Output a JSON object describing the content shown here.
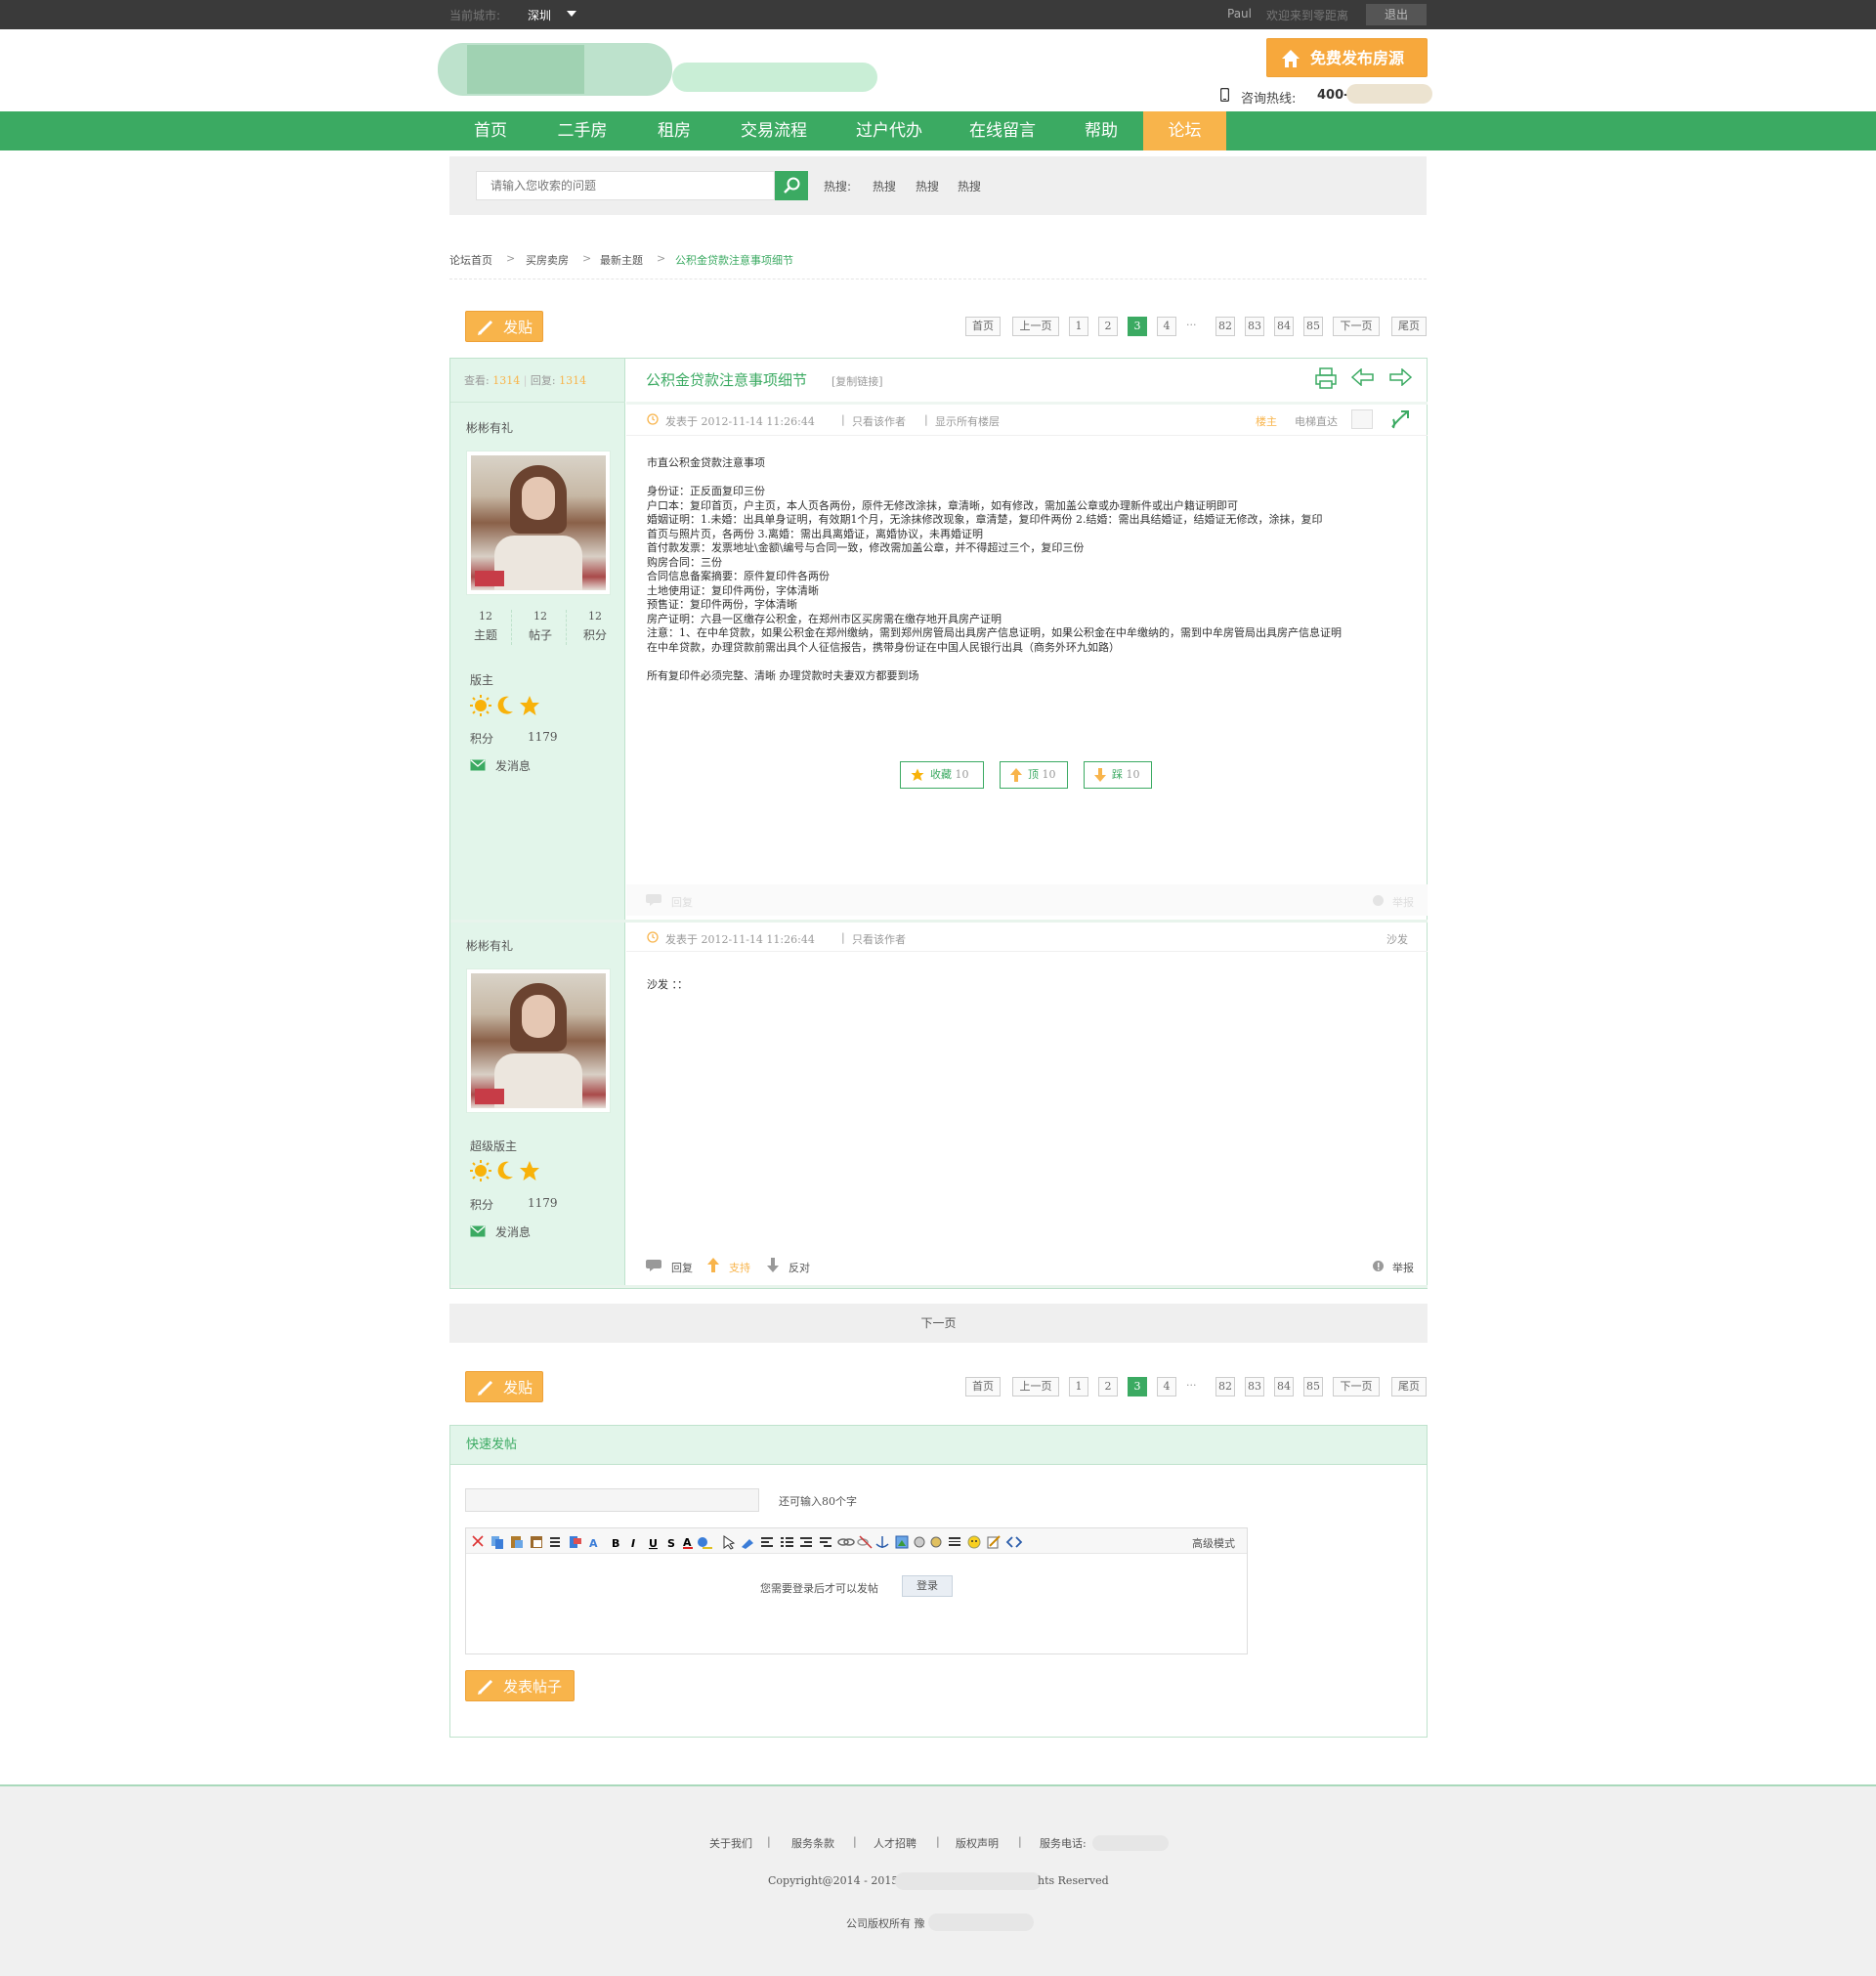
{
  "topbar": {
    "city_label": "当前城市:",
    "city_value": "深圳",
    "username": "Paul",
    "welcome": "欢迎来到零距离",
    "logout": "退出"
  },
  "header": {
    "publish_button": "免费发布房源",
    "hotline_label": "咨询热线:",
    "hotline_prefix": "400-"
  },
  "nav": {
    "items": [
      "首页",
      "二手房",
      "租房",
      "交易流程",
      "过户代办",
      "在线留言",
      "帮助",
      "论坛"
    ],
    "active_index": 7
  },
  "search": {
    "placeholder": "请输入您收索的问题",
    "hot_label": "热搜:",
    "hot_items": [
      "热搜",
      "热搜",
      "热搜"
    ]
  },
  "breadcrumb": [
    "论坛首页",
    "买房卖房",
    "最新主题",
    "公积金贷款注意事项细节"
  ],
  "post_button": "发贴",
  "pager": {
    "first": "首页",
    "prev": "上一页",
    "pages": [
      "1",
      "2",
      "3",
      "4"
    ],
    "current": "3",
    "ellipsis": "···",
    "tail_pages": [
      "82",
      "83",
      "84",
      "85"
    ],
    "next": "下一页",
    "last": "尾页"
  },
  "thread": {
    "views_label": "查看:",
    "views": "1314",
    "replies_label": "回复:",
    "replies": "1314",
    "title": "公积金贷款注意事项细节",
    "copy_link": "[复制链接]"
  },
  "post1": {
    "author": "彬彬有礼",
    "stats": [
      {
        "value": "12",
        "label": "主题"
      },
      {
        "value": "12",
        "label": "帖子"
      },
      {
        "value": "12",
        "label": "积分"
      }
    ],
    "role": "版主",
    "points_label": "积分",
    "points": "1179",
    "message_label": "发消息",
    "posted_at": "发表于 2012-11-14 11:26:44",
    "only_author": "只看该作者",
    "show_all": "显示所有楼层",
    "floor": "楼主",
    "elevator": "电梯直达",
    "body": [
      "市直公积金贷款注意事项",
      "",
      "身份证：正反面复印三份",
      "户口本：复印首页，户主页，本人页各两份，原件无修改涂抹，章清晰，如有修改，需加盖公章或办理新件或出户籍证明即可",
      "婚姻证明：1.未婚：出具单身证明，有效期1个月，无涂抹修改现象，章清楚，复印件两份    2.结婚：需出具结婚证，结婚证无修改，涂抹，复印",
      "首页与照片页，各两份    3.离婚：需出具离婚证，离婚协议，未再婚证明",
      "首付款发票：发票地址\\金额\\编号与合同一致，修改需加盖公章，并不得超过三个，复印三份",
      "购房合同：三份",
      "合同信息备案摘要：原件复印件各两份",
      "土地使用证：复印件两份，字体清晰",
      "预售证：复印件两份，字体清晰",
      "房产证明：六县一区缴存公积金，在郑州市区买房需在缴存地开具房产证明",
      "注意：1、在中牟贷款，如果公积金在郑州缴纳，需到郑州房管局出具房产信息证明，如果公积金在中牟缴纳的，需到中牟房管局出具房产信息证明",
      "在中牟贷款，办理贷款前需出具个人征信报告，携带身份证在中国人民银行出具（商务外环九如路）",
      "",
      "所有复印件必须完整、清晰 办理贷款时夫妻双方都要到场"
    ],
    "actions": [
      {
        "icon": "star-icon",
        "label": "收藏",
        "count": "10"
      },
      {
        "icon": "arrow-up-icon",
        "label": "顶",
        "count": "10"
      },
      {
        "icon": "arrow-down-icon",
        "label": "踩",
        "count": "10"
      }
    ],
    "reply_label": "回复",
    "report_label": "举报"
  },
  "post2": {
    "author": "彬彬有礼",
    "role": "超级版主",
    "points_label": "积分",
    "points": "1179",
    "message_label": "发消息",
    "posted_at": "发表于 2012-11-14 11:26:44",
    "only_author": "只看该作者",
    "floor": "沙发",
    "body": "沙发 ：：",
    "reply_label": "回复",
    "support_label": "支持",
    "oppose_label": "反对",
    "report_label": "举报"
  },
  "next_page_bar": "下一页",
  "quick_post": {
    "title": "快速发帖",
    "char_hint": "还可输入80个字",
    "advanced_mode": "高级模式",
    "login_hint": "您需要登录后才可以发帖",
    "login_button": "登录",
    "submit_button": "发表帖子"
  },
  "footer": {
    "links": [
      "关于我们",
      "服务条款",
      "人才招聘",
      "版权声明",
      "服务电话:"
    ],
    "copyright_start": "Copyright@2014 - 2015",
    "copyright_end": "hts Reserved",
    "rights": "公司版权所有 豫"
  },
  "colors": {
    "brand_green": "#3baa62",
    "accent_orange": "#f8b44b",
    "side_green": "#e2f5ea",
    "topbar": "#3a3a3a"
  }
}
